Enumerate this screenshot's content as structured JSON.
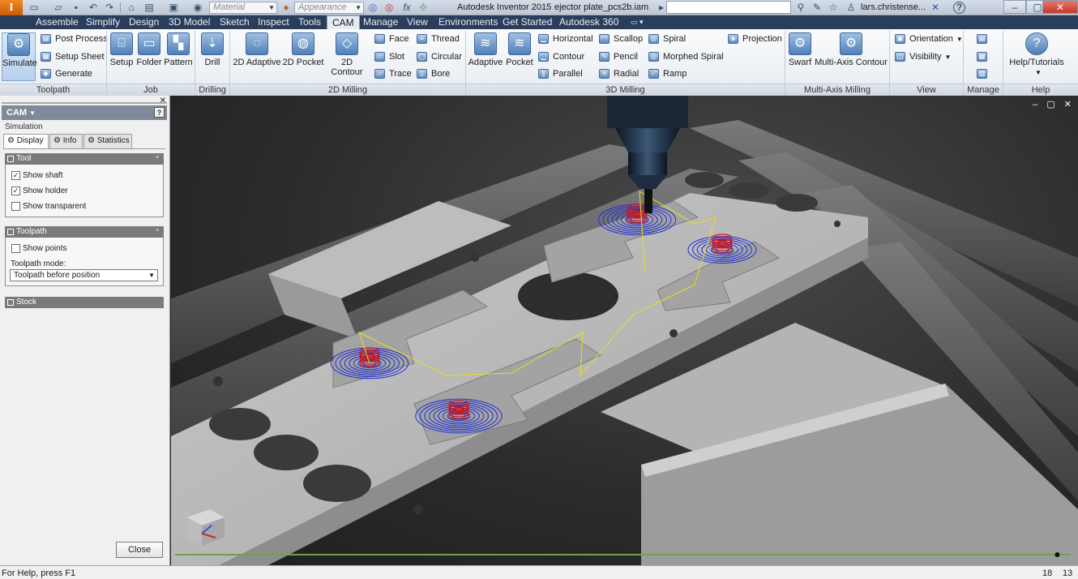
{
  "titlebar": {
    "logo": "I",
    "material_placeholder": "Material",
    "appearance_placeholder": "Appearance",
    "fx_label": "fx",
    "app_title": "Autodesk Inventor 2015",
    "file_name": "ejector plate_pcs2b.iam",
    "user": "lars.christense...",
    "help_icon": "?"
  },
  "menu": [
    "Assemble",
    "Simplify",
    "Design",
    "3D Model",
    "Sketch",
    "Inspect",
    "Tools",
    "CAM",
    "Manage",
    "View",
    "Environments",
    "Get Started",
    "Autodesk 360"
  ],
  "active_menu": "CAM",
  "ribbon": {
    "toolpath": {
      "title": "Toolpath",
      "simulate": "Simulate",
      "post_process": "Post Process",
      "setup_sheet": "Setup Sheet",
      "generate": "Generate"
    },
    "job": {
      "title": "Job",
      "setup": "Setup",
      "folder": "Folder",
      "pattern": "Pattern"
    },
    "drilling": {
      "title": "Drilling",
      "drill": "Drill"
    },
    "milling_2d": {
      "title": "2D Milling",
      "adaptive": "2D Adaptive",
      "pocket": "2D Pocket",
      "contour": "2D Contour",
      "face": "Face",
      "slot": "Slot",
      "trace": "Trace",
      "thread": "Thread",
      "circular": "Circular",
      "bore": "Bore"
    },
    "milling_3d": {
      "title": "3D Milling",
      "adaptive": "Adaptive",
      "pocket": "Pocket",
      "horizontal": "Horizontal",
      "contour": "Contour",
      "parallel": "Parallel",
      "scallop": "Scallop",
      "pencil": "Pencil",
      "radial": "Radial",
      "spiral": "Spiral",
      "morphed_spiral": "Morphed Spiral",
      "ramp": "Ramp",
      "projection": "Projection"
    },
    "multi_axis": {
      "title": "Multi-Axis Milling",
      "swarf": "Swarf",
      "multi_axis_contour": "Multi-Axis Contour"
    },
    "view": {
      "title": "View",
      "orientation": "Orientation",
      "visibility": "Visibility"
    },
    "manage": {
      "title": "Manage"
    },
    "help": {
      "title": "Help",
      "tutorials": "Help/Tutorials"
    }
  },
  "left_panel": {
    "header": "CAM",
    "help_icon": "?",
    "subtitle": "Simulation",
    "tabs": [
      "Display",
      "Info",
      "Statistics"
    ],
    "tool_section": {
      "title": "Tool",
      "show_shaft": "Show shaft",
      "show_shaft_checked": true,
      "show_holder": "Show holder",
      "show_holder_checked": true,
      "show_transparent": "Show transparent",
      "show_transparent_checked": false
    },
    "toolpath_section": {
      "title": "Toolpath",
      "show_points": "Show points",
      "show_points_checked": false,
      "mode_label": "Toolpath mode:",
      "mode_value": "Toolpath before position"
    },
    "stock_section": {
      "title": "Stock"
    },
    "close_label": "Close"
  },
  "viewport": {
    "simulation_progress": 0.985,
    "colors": {
      "toolpath": "#1f2fd8",
      "cut": "#d01515",
      "rapid": "#e8e020",
      "part": "#b9b9b9"
    }
  },
  "status": {
    "help_text": "For Help, press F1",
    "value_a": "18",
    "value_b": "13"
  }
}
